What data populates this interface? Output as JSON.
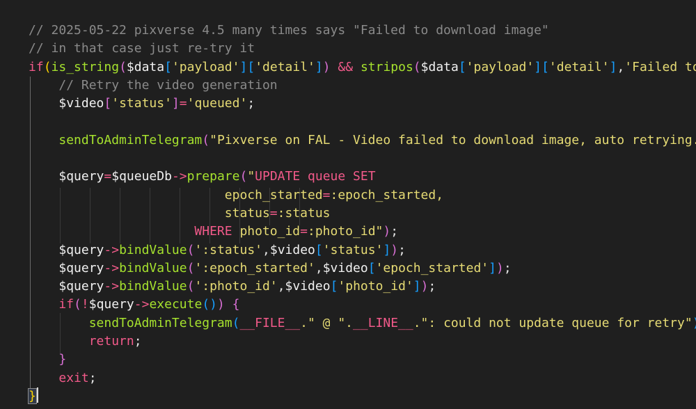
{
  "colors": {
    "background": "#1f1f1f",
    "comment": "#8a8a8a",
    "keyword": "#f25a8a",
    "function": "#a6e22e",
    "string": "#e6db74",
    "bracket_gold": "#ffd700",
    "bracket_purple": "#da70d6",
    "bracket_blue": "#179fff"
  },
  "code": {
    "l1": {
      "text": "// 2025-05-22 pixverse 4.5 many times says \"Failed to download image\""
    },
    "l2": {
      "text": "// in that case just re-try it"
    },
    "l3": {
      "kw_if": "if",
      "p_open": "(",
      "fn": "is_string",
      "p2_open": "(",
      "var": "$data",
      "b1o": "[",
      "s1": "'payload'",
      "b1c": "]",
      "b2o": "[",
      "s2": "'detail'",
      "b2c": "]",
      "p2_close": ")",
      "op": " && ",
      "fn2": "stripos",
      "p3_open": "(",
      "var2": "$data",
      "b3o": "[",
      "s3": "'payload'",
      "b3c": "]",
      "b4o": "[",
      "s4": "'detail'",
      "b4c": "]",
      "comma": ",",
      "s5": "'Failed to"
    },
    "l4": {
      "text": "// Retry the video generation"
    },
    "l5": {
      "var": "$video",
      "bo": "[",
      "key": "'status'",
      "bc": "]",
      "eq": "=",
      "val": "'queued'",
      "semi": ";"
    },
    "l7": {
      "fn": "sendToAdminTelegram",
      "po": "(",
      "str": "\"Pixverse on FAL - Video failed to download image, auto retrying."
    },
    "l9": {
      "var": "$query",
      "eq": "=",
      "var2": "$queueDb",
      "arrow": "->",
      "fn": "prepare",
      "po": "(",
      "q": "\"",
      "sql": "UPDATE queue SET"
    },
    "l10": {
      "col": "epoch_started",
      "eq": "=",
      "param": ":epoch_started",
      "comma": ","
    },
    "l11": {
      "col": "status",
      "eq": "=",
      "param": ":status"
    },
    "l12": {
      "sql": "WHERE",
      "col": " photo_id",
      "eq": "=",
      "param": ":photo_id",
      "q": "\"",
      "pc": ")",
      "semi": ";"
    },
    "l13": {
      "var": "$query",
      "arrow": "->",
      "fn": "bindValue",
      "po": "(",
      "s": "':status'",
      "comma": ",",
      "var2": "$video",
      "bo": "[",
      "k": "'status'",
      "bc": "]",
      "pc": ")",
      "semi": ";"
    },
    "l14": {
      "var": "$query",
      "arrow": "->",
      "fn": "bindValue",
      "po": "(",
      "s": "':epoch_started'",
      "comma": ",",
      "var2": "$video",
      "bo": "[",
      "k": "'epoch_started'",
      "bc": "]",
      "pc": ")",
      "semi": ";"
    },
    "l15": {
      "var": "$query",
      "arrow": "->",
      "fn": "bindValue",
      "po": "(",
      "s": "':photo_id'",
      "comma": ",",
      "var2": "$video",
      "bo": "[",
      "k": "'photo_id'",
      "bc": "]",
      "pc": ")",
      "semi": ";"
    },
    "l16": {
      "kw": "if",
      "po": "(",
      "not": "!",
      "var": "$query",
      "arrow": "->",
      "fn": "execute",
      "p2": "()",
      "pc": ")",
      "brace": " {"
    },
    "l17": {
      "fn": "sendToAdminTelegram",
      "po": "(",
      "c1": "__FILE__",
      "s1": ".\" @ \".",
      "c2": "__LINE__",
      "s2": ".\": could not update queue for retry\"",
      "pc": ")",
      "semi": ";"
    },
    "l18": {
      "kw": "return",
      "semi": ";"
    },
    "l19": {
      "brace": "}"
    },
    "l20": {
      "kw": "exit",
      "semi": ";"
    },
    "l21": {
      "brace": "}"
    }
  }
}
